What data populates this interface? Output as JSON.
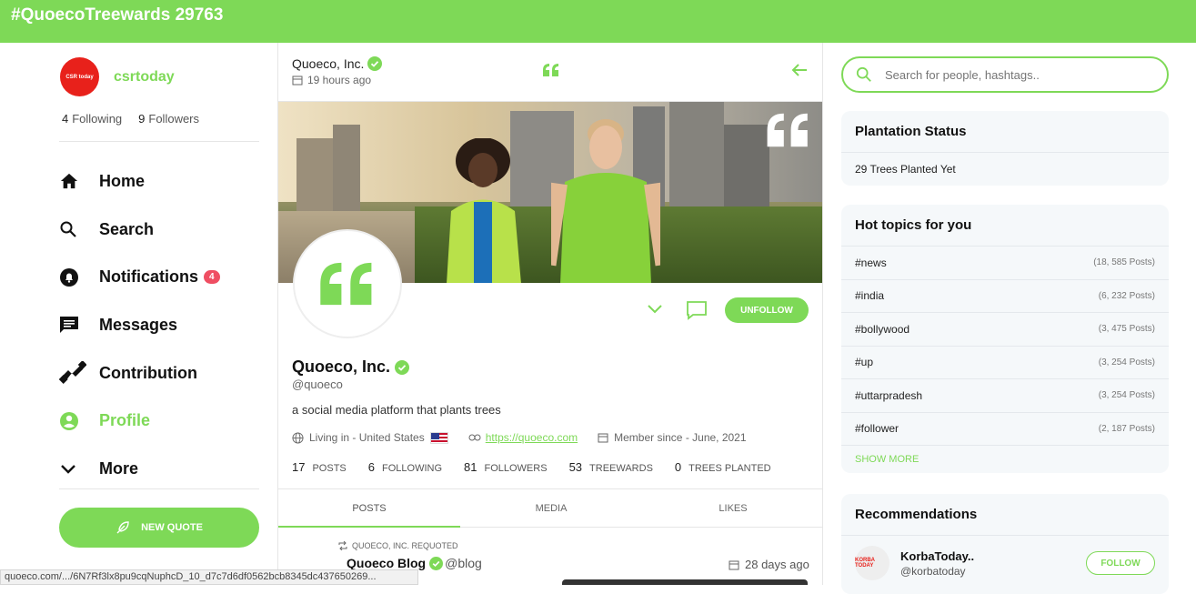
{
  "topbar": {
    "title": "#QuoecoTreewards 29763"
  },
  "user": {
    "avatar_text": "CSR today",
    "name": "csrtoday",
    "following_count": "4",
    "following_label": "Following",
    "followers_count": "9",
    "followers_label": "Followers"
  },
  "nav": {
    "home": "Home",
    "search": "Search",
    "notifications": "Notifications",
    "notifications_badge": "4",
    "messages": "Messages",
    "contribution": "Contribution",
    "profile": "Profile",
    "more": "More"
  },
  "new_quote_label": "NEW QUOTE",
  "header": {
    "name": "Quoeco, Inc.",
    "time": "19 hours ago"
  },
  "profile": {
    "name": "Quoeco, Inc.",
    "handle": "@quoeco",
    "bio": "a social media platform that plants trees",
    "location": "Living in - United States",
    "website": "https://quoeco.com",
    "member_since": "Member since - June, 2021",
    "unfollow_label": "UNFOLLOW",
    "stats": [
      {
        "value": "17",
        "label": "POSTS"
      },
      {
        "value": "6",
        "label": "FOLLOWING"
      },
      {
        "value": "81",
        "label": "FOLLOWERS"
      },
      {
        "value": "53",
        "label": "TREEWARDS"
      },
      {
        "value": "0",
        "label": "TREES PLANTED"
      }
    ]
  },
  "tabs": [
    "POSTS",
    "MEDIA",
    "LIKES"
  ],
  "post": {
    "requoted": "QUOECO, INC. REQUOTED",
    "name": "Quoeco Blog",
    "handle": "@blog",
    "time": "28 days ago"
  },
  "search": {
    "placeholder": "Search for people, hashtags.."
  },
  "plantation": {
    "title": "Plantation Status",
    "text": "29 Trees Planted Yet"
  },
  "hot_topics": {
    "title": "Hot topics for you",
    "items": [
      {
        "tag": "#news",
        "count": "(18, 585 Posts)"
      },
      {
        "tag": "#india",
        "count": "(6, 232 Posts)"
      },
      {
        "tag": "#bollywood",
        "count": "(3, 475 Posts)"
      },
      {
        "tag": "#up",
        "count": "(3, 254 Posts)"
      },
      {
        "tag": "#uttarpradesh",
        "count": "(3, 254 Posts)"
      },
      {
        "tag": "#follower",
        "count": "(2, 187 Posts)"
      }
    ],
    "show_more": "SHOW MORE"
  },
  "recommendations": {
    "title": "Recommendations",
    "items": [
      {
        "avatar_text": "KORBA TODAY",
        "name": "KorbaToday..",
        "handle": "@korbatoday",
        "button": "FOLLOW"
      }
    ]
  },
  "status_url": "quoeco.com/.../6N7Rf3lx8pu9cqNuphcD_10_d7c7d6df0562bcb8345dc437650269...",
  "colors": {
    "accent": "#7ed957",
    "badge": "#ef4e62"
  }
}
